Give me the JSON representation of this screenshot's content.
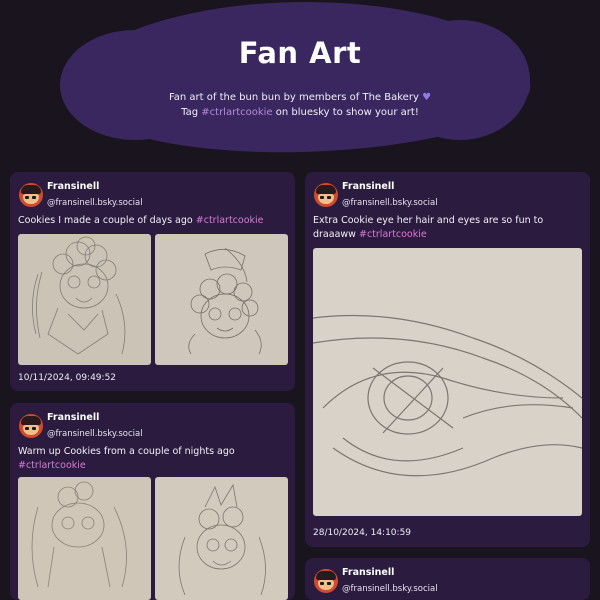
{
  "header": {
    "title": "Fan Art",
    "subtitle_line1": "Fan art of the bun bun by members of The Bakery",
    "heart": "♥",
    "subtitle_tag_prefix": "Tag",
    "subtitle_tag": "#ctrlartcookie",
    "subtitle_tag_suffix": "on bluesky to show your art!"
  },
  "colors": {
    "background": "#19141d",
    "header_blob": "#3a2760",
    "card": "#2b1c3f",
    "hashtag": "#d77ad6",
    "heart": "#8f7be6"
  },
  "posts": [
    {
      "author": "Fransinell",
      "handle": "@fransinell.bsky.social",
      "text": "Cookies I made a couple of days ago",
      "hashtag": "#ctrlartcookie",
      "date": "10/11/2024, 09:49:52",
      "images": [
        "sketch-cookie-portrait",
        "sketch-cookie-chibi"
      ]
    },
    {
      "author": "Fransinell",
      "handle": "@fransinell.bsky.social",
      "text": "Extra Cookie eye her hair and eyes are so fun to draaaww",
      "hashtag": "#ctrlartcookie",
      "date": "28/10/2024, 14:10:59",
      "images": [
        "sketch-cookie-eye-closeup"
      ]
    },
    {
      "author": "Fransinell",
      "handle": "@fransinell.bsky.social",
      "text": "Warm up Cookies from a couple of nights ago",
      "hashtag": "#ctrlartcookie",
      "images": [
        "sketch-warmup-1",
        "sketch-warmup-2"
      ]
    },
    {
      "author": "Fransinell",
      "handle": "@fransinell.bsky.social"
    }
  ]
}
